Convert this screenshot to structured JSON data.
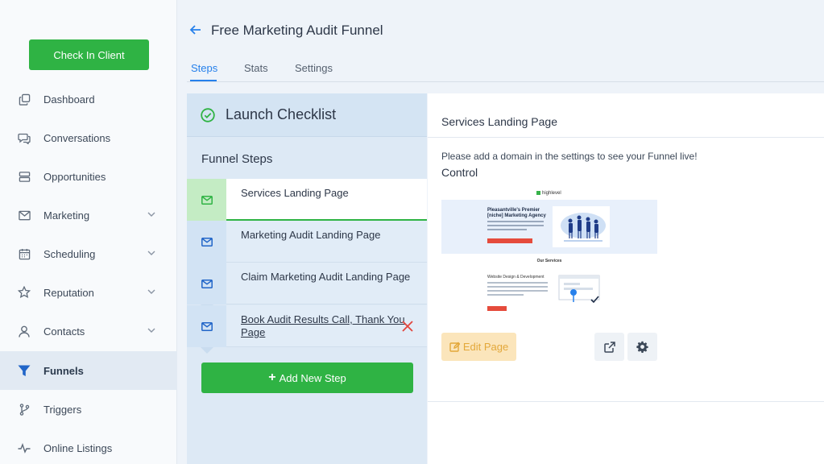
{
  "sidebar": {
    "checkin_label": "Check In Client",
    "items": [
      {
        "label": "Dashboard",
        "icon": "copy-icon"
      },
      {
        "label": "Conversations",
        "icon": "chat-icon"
      },
      {
        "label": "Opportunities",
        "icon": "layers-icon"
      },
      {
        "label": "Marketing",
        "icon": "mail-icon",
        "expandable": true
      },
      {
        "label": "Scheduling",
        "icon": "calendar-icon",
        "expandable": true
      },
      {
        "label": "Reputation",
        "icon": "star-icon",
        "expandable": true
      },
      {
        "label": "Contacts",
        "icon": "user-icon",
        "expandable": true
      },
      {
        "label": "Funnels",
        "icon": "filter-icon",
        "active": true
      },
      {
        "label": "Triggers",
        "icon": "branch-icon"
      },
      {
        "label": "Online Listings",
        "icon": "pulse-icon"
      }
    ]
  },
  "header": {
    "title": "Free Marketing Audit Funnel",
    "tabs": [
      {
        "label": "Steps",
        "active": true
      },
      {
        "label": "Stats"
      },
      {
        "label": "Settings"
      }
    ]
  },
  "left_panel": {
    "launch_checklist": "Launch Checklist",
    "funnel_steps_label": "Funnel Steps",
    "steps": [
      {
        "name": "Services Landing Page",
        "active": true
      },
      {
        "name": "Marketing Audit Landing Page"
      },
      {
        "name": "Claim Marketing Audit Landing Page"
      },
      {
        "name": "Book Audit Results Call, Thank You Page",
        "hovered": true
      }
    ],
    "add_step_label": "Add New Step"
  },
  "right_panel": {
    "title": "Services Landing Page",
    "domain_note": "Please add a domain in the settings to see your Funnel live!",
    "variant_label": "Control",
    "preview": {
      "logo_text": "highlevel",
      "hero_heading": "Pleasantville's Premier [niche] Marketing Agency",
      "services_heading": "Our Services",
      "service_title": "Website Design & Development"
    },
    "edit_page_label": "Edit Page"
  },
  "colors": {
    "primary_green": "#2fb344",
    "accent_blue": "#2680eb",
    "edit_button_bg": "#fbe5bb",
    "edit_button_text": "#e3a83a"
  }
}
